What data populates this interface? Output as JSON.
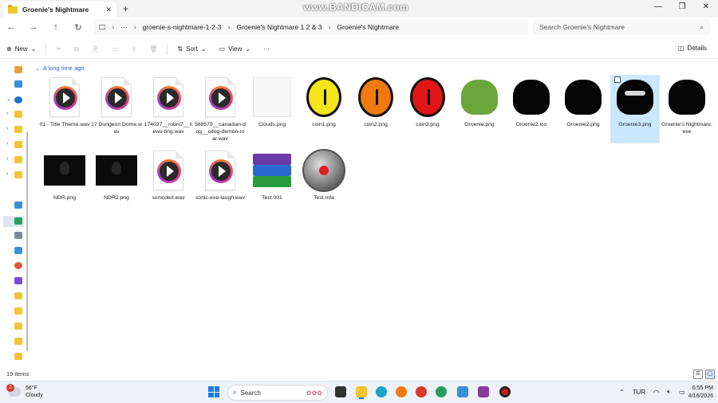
{
  "window": {
    "tab_title": "Groenie's Nightmare",
    "tab_close": "✕",
    "new_tab": "+",
    "watermark": "www.BANDICAM.com",
    "controls": [
      "—",
      "❐",
      "✕"
    ]
  },
  "nav": {
    "back": "←",
    "forward": "→",
    "up": "↑",
    "refresh": "↻",
    "breadcrumb": [
      "groenie-s-nightmare-1-2-3",
      "Groenie's Nightmare 1 2 & 3",
      "Groenie's Nightmare"
    ],
    "more": "···",
    "search_placeholder": "Search Groenie's Nightmare"
  },
  "toolbar": {
    "new_label": "New",
    "sort_label": "Sort",
    "view_label": "View",
    "more": "···",
    "details_label": "Details"
  },
  "group": {
    "label": "A long time ago"
  },
  "files": [
    {
      "name": "01 - Title Theme.wav",
      "kind": "wav"
    },
    {
      "name": "17 Dungeon Dome.wav",
      "kind": "wav"
    },
    {
      "name": "174027__robni7__news-ting.wav",
      "kind": "wav"
    },
    {
      "name": "588579__canadian-dog__cdog-demon-roar.wav",
      "kind": "wav"
    },
    {
      "name": "Clouds.png",
      "kind": "blank"
    },
    {
      "name": "coin1.png",
      "kind": "coin",
      "color": "#f5e51a"
    },
    {
      "name": "coin2.png",
      "kind": "coin",
      "color": "#f07a10"
    },
    {
      "name": "coin3.png",
      "kind": "coin",
      "color": "#e01616"
    },
    {
      "name": "Groenie.png",
      "kind": "green"
    },
    {
      "name": "Groenie2.ico",
      "kind": "black"
    },
    {
      "name": "Groenie2.png",
      "kind": "black"
    },
    {
      "name": "Groenie3.png",
      "kind": "black-eyes",
      "selected": true
    },
    {
      "name": "Groenie's Nightmare.exe",
      "kind": "black"
    },
    {
      "name": "NDR.png",
      "kind": "dark"
    },
    {
      "name": "NDR2.png",
      "kind": "dark"
    },
    {
      "name": "sonicded.wav",
      "kind": "wav"
    },
    {
      "name": "sonic-exe-laugh.wav",
      "kind": "wav"
    },
    {
      "name": "Test.001",
      "kind": "winrar"
    },
    {
      "name": "Test.mfa",
      "kind": "mfa"
    }
  ],
  "status": {
    "item_count": "19 items"
  },
  "taskbar": {
    "weather_temp": "56°F",
    "weather_desc": "Cloudy",
    "weather_badge": "2",
    "search_label": "Search",
    "language": "TUR",
    "time": "6:55 PM",
    "date": "4/16/2026"
  }
}
